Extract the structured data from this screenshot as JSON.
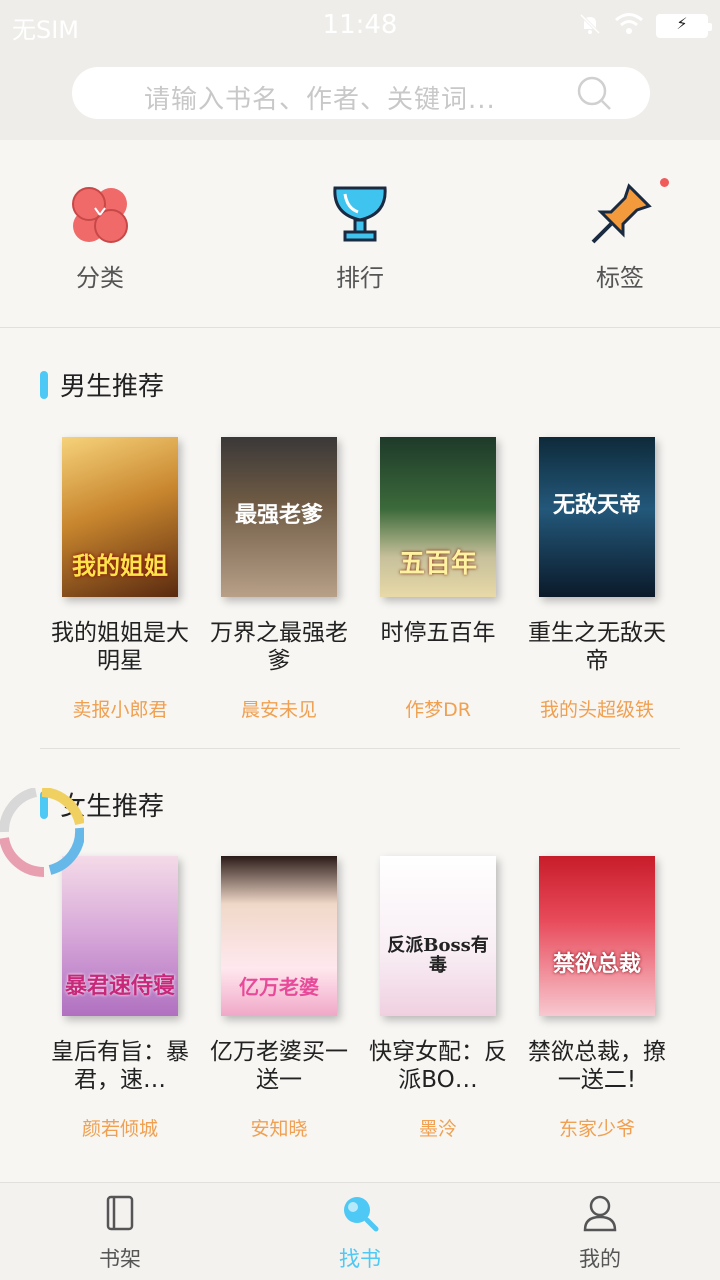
{
  "status_bar": {
    "carrier": "无SIM",
    "time": "11:48"
  },
  "search": {
    "placeholder": "请输入书名、作者、关键词..."
  },
  "quick_nav": [
    {
      "label": "分类",
      "icon": "clover-icon"
    },
    {
      "label": "排行",
      "icon": "trophy-icon"
    },
    {
      "label": "标签",
      "icon": "pin-icon"
    }
  ],
  "male_section": {
    "title": "男生推荐",
    "books": [
      {
        "title": "我的姐姐是大明星",
        "author": "卖报小郎君",
        "cover_text": "我的姐姐"
      },
      {
        "title": "万界之最强老爹",
        "author": "晨安未见",
        "cover_text": "最强老爹"
      },
      {
        "title": "时停五百年",
        "author": "作梦DR",
        "cover_text": "五百年"
      },
      {
        "title": "重生之无敌天帝",
        "author": "我的头超级铁",
        "cover_text": "无敌天帝"
      }
    ]
  },
  "female_section": {
    "title": "女生推荐",
    "books": [
      {
        "title": "皇后有旨：暴君，速…",
        "author": "颜若倾城",
        "cover_text": "暴君速侍寝"
      },
      {
        "title": "亿万老婆买一送一",
        "author": "安知晓",
        "cover_text": "亿万老婆"
      },
      {
        "title": "快穿女配：反派BO…",
        "author": "墨泠",
        "cover_text": "反派Boss有毒"
      },
      {
        "title": "禁欲总裁，撩一送二!",
        "author": "东家少爷",
        "cover_text": "禁欲总裁"
      }
    ]
  },
  "tabbar": [
    {
      "label": "书架",
      "icon": "bookshelf-icon",
      "active": false
    },
    {
      "label": "找书",
      "icon": "search-icon",
      "active": true
    },
    {
      "label": "我的",
      "icon": "profile-icon",
      "active": false
    }
  ],
  "colors": {
    "accent": "#4ec8f4",
    "author": "#f0a050",
    "badge": "#f05a5a"
  }
}
